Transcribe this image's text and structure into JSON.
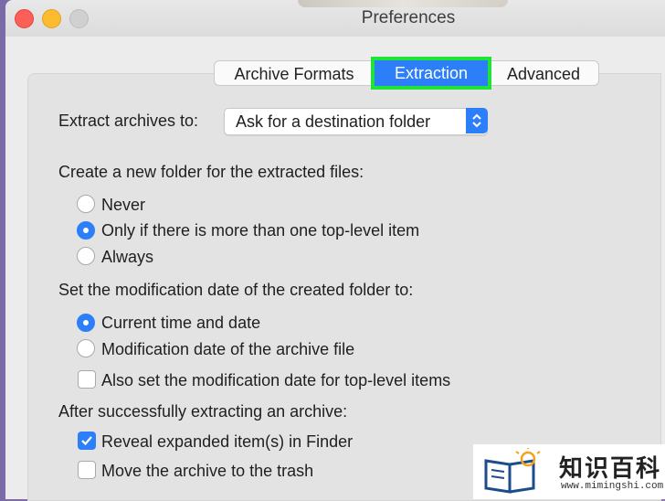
{
  "window": {
    "title": "Preferences"
  },
  "tabs": [
    {
      "label": "Archive Formats",
      "active": false
    },
    {
      "label": "Extraction",
      "active": true
    },
    {
      "label": "Advanced",
      "active": false
    }
  ],
  "extract_to": {
    "label": "Extract archives to:",
    "selected": "Ask for a destination folder"
  },
  "new_folder": {
    "heading": "Create a new folder for the extracted files:",
    "options": [
      {
        "label": "Never",
        "selected": false
      },
      {
        "label": "Only if there is more than one top-level item",
        "selected": true
      },
      {
        "label": "Always",
        "selected": false
      }
    ]
  },
  "mod_date": {
    "heading": "Set the modification date of the created folder to:",
    "options": [
      {
        "label": "Current time and date",
        "selected": true
      },
      {
        "label": "Modification date of the archive file",
        "selected": false
      }
    ],
    "also_set": {
      "label": "Also set the modification date for top-level items",
      "checked": false
    }
  },
  "after_extract": {
    "heading": "After successfully extracting an archive:",
    "reveal": {
      "label": "Reveal expanded item(s) in Finder",
      "checked": true
    },
    "trash": {
      "label": "Move the archive to the trash",
      "checked": false
    }
  },
  "watermark": {
    "text": "知识百科",
    "url": "www.mimingshi.com"
  },
  "colors": {
    "accent": "#2d7ff9",
    "highlight": "#20e33a"
  }
}
